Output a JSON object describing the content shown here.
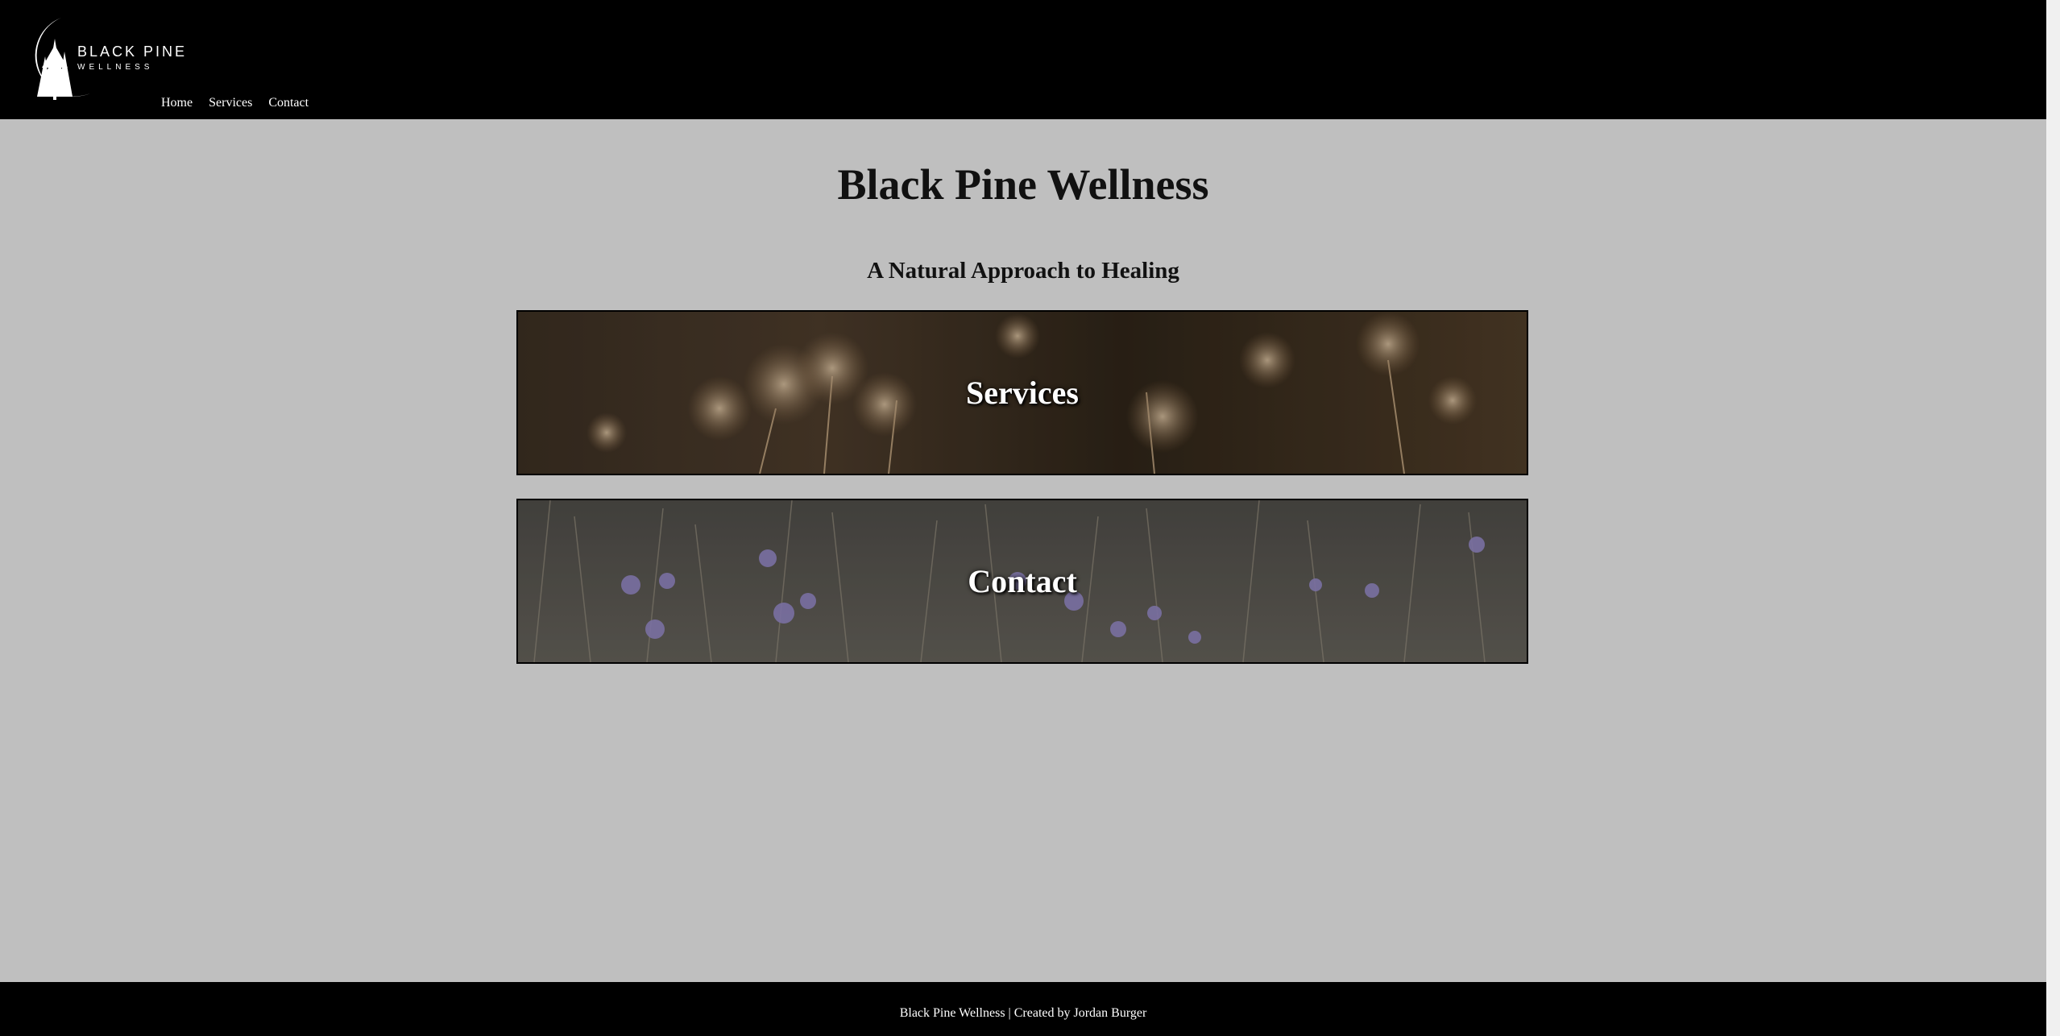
{
  "header": {
    "logo_line1": "BLACK PINE",
    "logo_line2": "WELLNESS",
    "nav": {
      "home": "Home",
      "services": "Services",
      "contact": "Contact"
    }
  },
  "main": {
    "title": "Black Pine Wellness",
    "subtitle": "A Natural Approach to Healing",
    "banners": {
      "services_label": "Services",
      "contact_label": "Contact"
    }
  },
  "footer": {
    "text": "Black Pine Wellness | Created by Jordan Burger"
  },
  "colors": {
    "header_bg": "#000000",
    "page_bg": "#bfbfbf",
    "footer_bg": "#000000",
    "text_dark": "#111111",
    "text_light": "#ffffff"
  },
  "icons": {
    "logo": "crescent-pine-tree-icon"
  }
}
